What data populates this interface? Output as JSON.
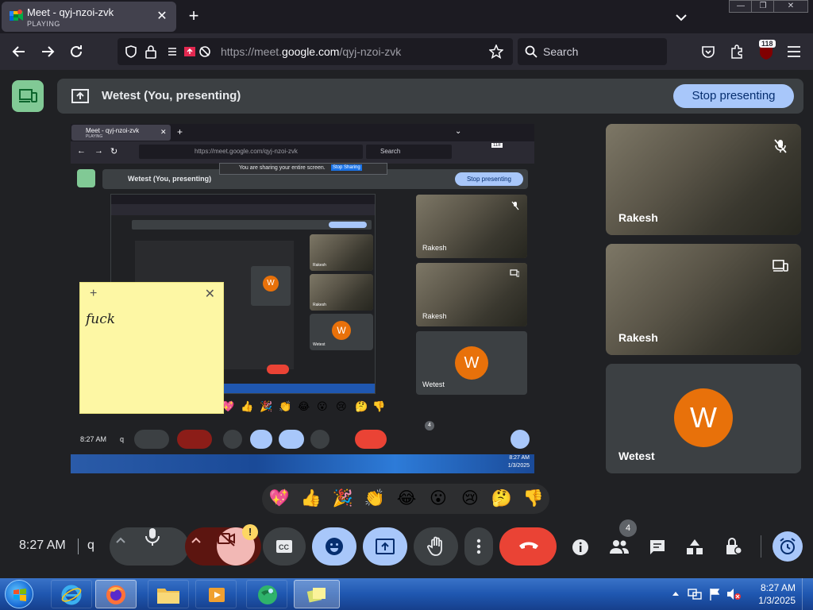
{
  "browser": {
    "tab": {
      "title": "Meet - qyj-nzoi-zvk",
      "subtitle": "PLAYING",
      "close": "✕"
    },
    "new_tab": "+",
    "url": {
      "prefix": "https://meet.",
      "domain": "google.com",
      "path": "/qyj-nzoi-zvk"
    },
    "search_placeholder": "Search",
    "extension_badge": "118",
    "window_controls": [
      "—",
      "❐",
      "✕"
    ]
  },
  "meet": {
    "presenting_title": "Wetest (You, presenting)",
    "stop_presenting": "Stop presenting",
    "share_notice": "You are sharing your entire screen.",
    "stop_sharing": "Stop Sharing",
    "share_minimize": "—",
    "participants": [
      {
        "name": "Rakesh",
        "status_icon": "mic-off-icon"
      },
      {
        "name": "Rakesh",
        "status_icon": "presenting-icon"
      },
      {
        "name": "Wetest",
        "avatar_letter": "W"
      }
    ],
    "reactions": [
      "💖",
      "👍",
      "🎉",
      "👏",
      "😂",
      "😮",
      "😢",
      "🤔",
      "👎"
    ],
    "time": "8:27 AM",
    "meeting_code": "q",
    "people_count": "4",
    "camera_warning": "!"
  },
  "preview": {
    "tab_title": "Meet - qyj-nzoi-zvk",
    "tab_sub": "PLAYING",
    "url": "https://meet.google.com/qyj-nzoi-zvk",
    "search": "Search",
    "badge": "118",
    "presenting_title": "Wetest (You, presenting)",
    "stop_presenting": "Stop presenting",
    "share_notice": "You are sharing your entire screen.",
    "stop_sharing": "Stop Sharing",
    "time": "8:27 AM",
    "code": "q",
    "count": "4",
    "tiles": [
      {
        "name": "Rakesh"
      },
      {
        "name": "Rakesh"
      },
      {
        "name": "Wetest",
        "letter": "W"
      }
    ],
    "inner_tile_names": [
      "Rakesh",
      "Rakesh",
      "Wetest"
    ],
    "inner_avatar_letters": [
      "W",
      "W"
    ],
    "reactions": [
      "💖",
      "👍",
      "🎉",
      "👏",
      "😂",
      "😮",
      "😢",
      "🤔",
      "👎"
    ],
    "clock_time": "8:27 AM",
    "clock_date": "1/3/2025"
  },
  "sticky": {
    "plus": "+",
    "close": "✕",
    "text": "fuck"
  },
  "taskbar": {
    "clock_time": "8:27 AM",
    "clock_date": "1/3/2025"
  }
}
